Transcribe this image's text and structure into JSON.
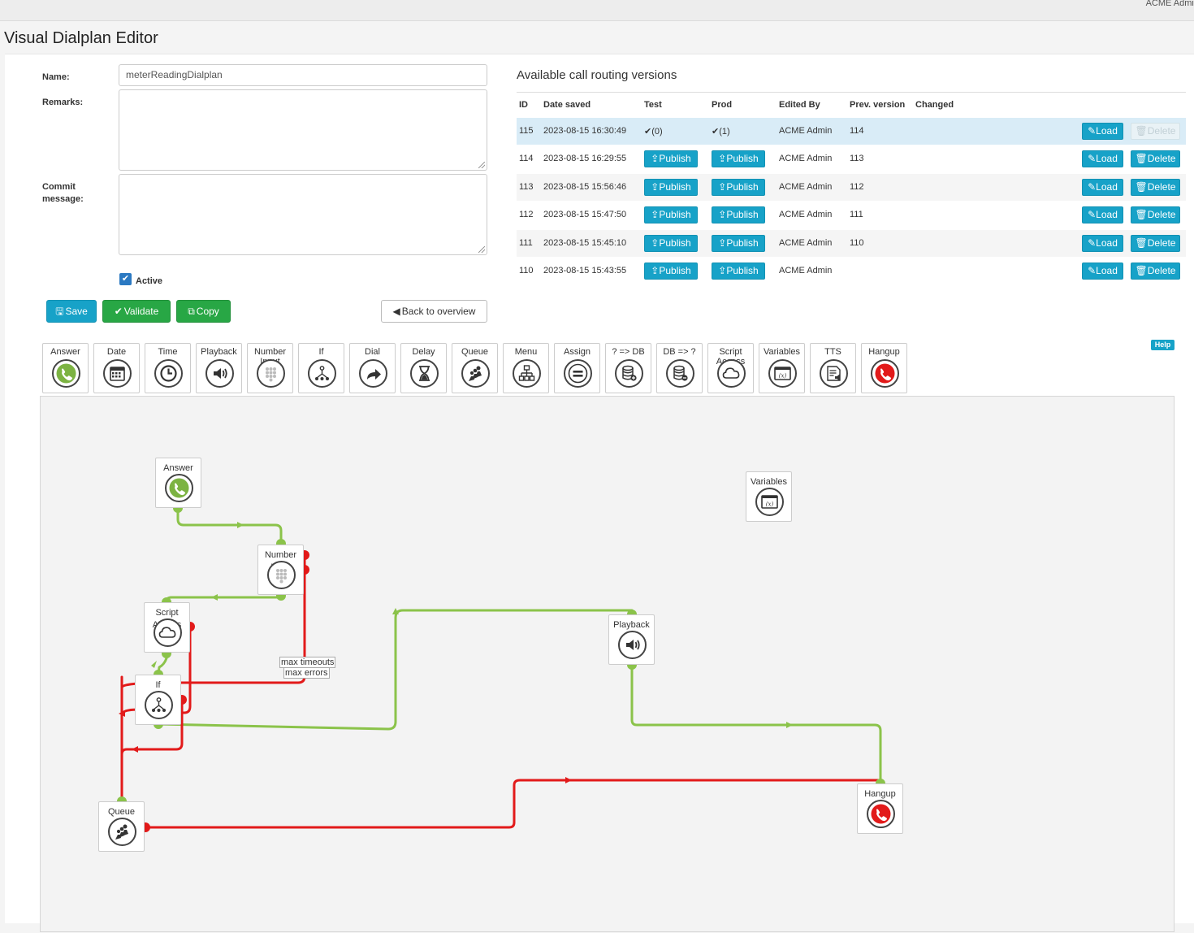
{
  "topbar": {
    "user": "ACME Admin"
  },
  "page": {
    "title": "Visual Dialplan Editor"
  },
  "form": {
    "name_label": "Name:",
    "name_value": "meterReadingDialplan",
    "remarks_label": "Remarks:",
    "remarks_value": "",
    "commit_label": "Commit message:",
    "commit_value": "",
    "active_label": "Active",
    "active_checked": true,
    "save_label": "Save",
    "validate_label": "Validate",
    "copy_label": "Copy",
    "back_label": "Back to overview"
  },
  "versions": {
    "title": "Available call routing versions",
    "headers": [
      "ID",
      "Date saved",
      "Test",
      "Prod",
      "Edited By",
      "Prev. version",
      "Changed"
    ],
    "load_label": "Load",
    "delete_label": "Delete",
    "publish_label": "Publish",
    "rows": [
      {
        "id": "115",
        "date": "2023-08-15 16:30:49",
        "test": "(0)",
        "prod": "(1)",
        "editor": "ACME Admin",
        "prev": "114",
        "published": true
      },
      {
        "id": "114",
        "date": "2023-08-15 16:29:55",
        "test": "",
        "prod": "",
        "editor": "ACME Admin",
        "prev": "113",
        "published": false
      },
      {
        "id": "113",
        "date": "2023-08-15 15:56:46",
        "test": "",
        "prod": "",
        "editor": "ACME Admin",
        "prev": "112",
        "published": false
      },
      {
        "id": "112",
        "date": "2023-08-15 15:47:50",
        "test": "",
        "prod": "",
        "editor": "ACME Admin",
        "prev": "111",
        "published": false
      },
      {
        "id": "111",
        "date": "2023-08-15 15:45:10",
        "test": "",
        "prod": "",
        "editor": "ACME Admin",
        "prev": "110",
        "published": false
      },
      {
        "id": "110",
        "date": "2023-08-15 15:43:55",
        "test": "",
        "prod": "",
        "editor": "ACME Admin",
        "prev": "",
        "published": false
      }
    ]
  },
  "palette": {
    "help_label": "Help",
    "items": [
      {
        "label": "Answer",
        "icon": "phone-icon"
      },
      {
        "label": "Date",
        "icon": "calendar-icon"
      },
      {
        "label": "Time",
        "icon": "clock-icon"
      },
      {
        "label": "Playback",
        "icon": "speaker-icon"
      },
      {
        "label": "Number Input",
        "icon": "keypad-icon"
      },
      {
        "label": "If",
        "icon": "branch-icon"
      },
      {
        "label": "Dial",
        "icon": "forward-arrow-icon"
      },
      {
        "label": "Delay",
        "icon": "hourglass-icon"
      },
      {
        "label": "Queue",
        "icon": "queue-icon"
      },
      {
        "label": "Menu",
        "icon": "sitemap-icon"
      },
      {
        "label": "Assign",
        "icon": "equals-icon"
      },
      {
        "label": "? => DB",
        "icon": "database-in-icon"
      },
      {
        "label": "DB => ?",
        "icon": "database-out-icon"
      },
      {
        "label": "Script Access",
        "icon": "cloud-icon"
      },
      {
        "label": "Variables",
        "icon": "variables-icon"
      },
      {
        "label": "TTS",
        "icon": "tts-icon"
      },
      {
        "label": "Hangup",
        "icon": "hangup-icon"
      }
    ]
  },
  "canvas": {
    "nodes": [
      {
        "label": "Answer",
        "icon": "phone-icon"
      },
      {
        "label": "Variables",
        "icon": "variables-icon"
      },
      {
        "label": "Number Input",
        "icon": "keypad-icon"
      },
      {
        "label": "Script Access",
        "icon": "cloud-icon"
      },
      {
        "label": "If",
        "icon": "branch-icon"
      },
      {
        "label": "Playback",
        "icon": "speaker-icon"
      },
      {
        "label": "Queue",
        "icon": "queue-icon"
      },
      {
        "label": "Hangup",
        "icon": "hangup-icon"
      }
    ],
    "wire_labels": [
      "max timeouts",
      "max errors"
    ],
    "colors": {
      "success": "#8bc34a",
      "error": "#e21a1a",
      "accent": "#17a2c8"
    }
  }
}
